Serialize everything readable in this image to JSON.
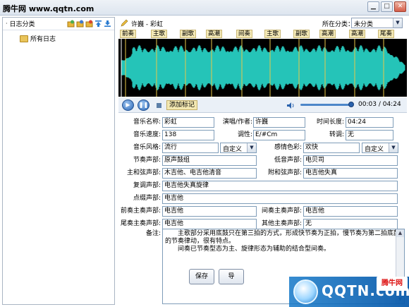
{
  "window": {
    "title": "腾牛网 www.qqtn.com"
  },
  "sidebar": {
    "header": "日志分类",
    "items": [
      {
        "label": "所有日志"
      }
    ]
  },
  "song": {
    "title": "许巍 - 彩虹"
  },
  "category": {
    "label": "所在分类：",
    "value": "未分类"
  },
  "marks": [
    "前奏",
    "主歌",
    "副歌",
    "高潮",
    "间奏",
    "主歌",
    "副歌",
    "高潮",
    "高潮",
    "尾奏"
  ],
  "player": {
    "add_mark": "添加标记",
    "current": "00:03",
    "sep": "/",
    "total": "04:24",
    "progress": 0.01
  },
  "form": {
    "name_label": "音乐名称:",
    "name_value": "彩虹",
    "artist_label": "演唱/作者:",
    "artist_value": "许巍",
    "duration_label": "时间长度:",
    "duration_value": "04:24",
    "tempo_label": "音乐速度:",
    "tempo_value": "138",
    "key_label": "调性:",
    "key_value": "E/#Cm",
    "modulation_label": "转调:",
    "modulation_value": "无",
    "style_label": "音乐风格:",
    "style_value": "流行",
    "style_select": "自定义",
    "mood_label": "感情色彩:",
    "mood_value": "欢快",
    "mood_select": "自定义",
    "rhythm_label": "节奏声部:",
    "rhythm_value": "原声鼓组",
    "bass_label": "低音声部:",
    "bass_value": "电贝司",
    "harmony_label": "主和弦声部:",
    "harmony_value": "木吉他、电吉他清音",
    "aux_harmony_label": "附和弦声部:",
    "aux_harmony_value": "电吉他失真",
    "counter_label": "复调声部:",
    "counter_value": "电吉他失真旋律",
    "fill_label": "点缀声部:",
    "fill_value": "电吉他",
    "intro_label": "前奏主奏声部:",
    "intro_value": "电吉他",
    "interlude_label": "间奏主奏声部:",
    "interlude_value": "电吉他",
    "outro_label": "尾奏主奏声部:",
    "outro_value": "电吉他",
    "other_label": "其他主奏声部:",
    "other_value": "无",
    "notes_label": "备注:",
    "notes_line1": "主歌部分采用底鼓只在第三拍的方式，形成快节奏为正拍，慢节奏为第二拍底鼓的节奏律动，很有特点。",
    "notes_line2": "间奏已节奏型态为主、旋律形态为辅助的结合型间奏。"
  },
  "buttons": {
    "save": "保存",
    "apply": "导"
  },
  "watermark": {
    "text": "QQTN.com",
    "badge": "腾牛网"
  }
}
